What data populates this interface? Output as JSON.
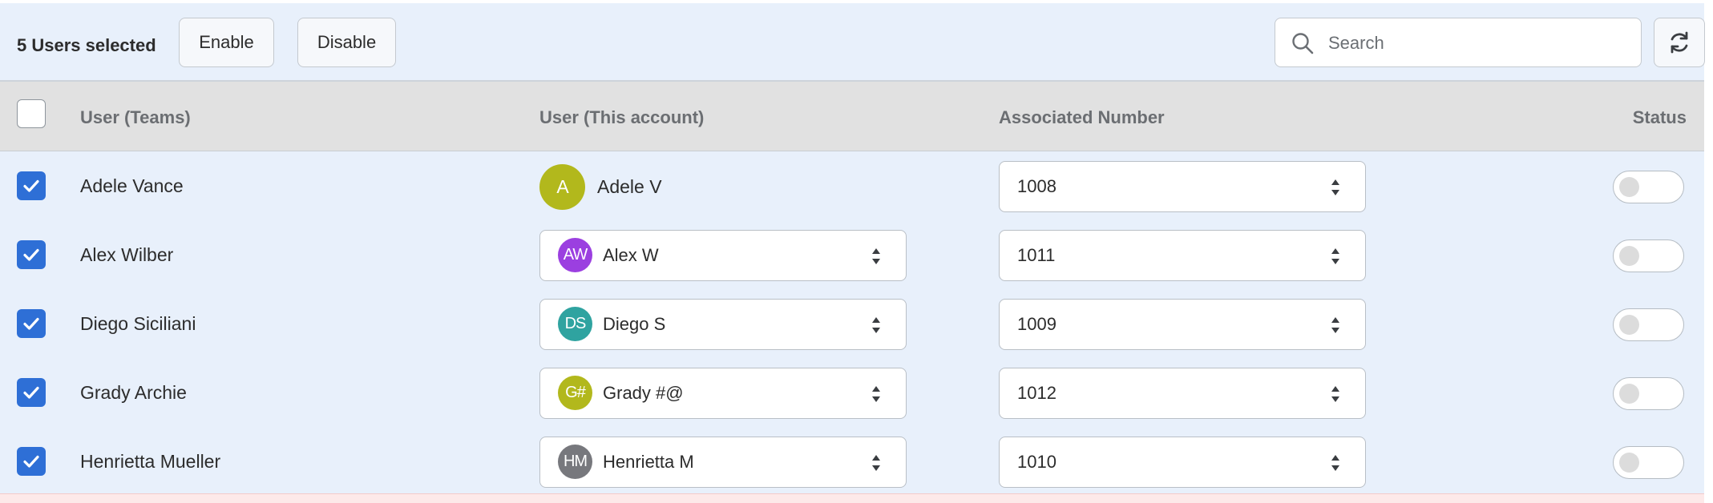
{
  "toolbar": {
    "selected_text": "5 Users selected",
    "enable_label": "Enable",
    "disable_label": "Disable",
    "search_placeholder": "Search",
    "search_value": ""
  },
  "columns": {
    "teams": "User (Teams)",
    "account": "User (This account)",
    "number": "Associated Number",
    "status": "Status"
  },
  "header_checkbox_checked": false,
  "rows": [
    {
      "teams_user": "Adele Vance",
      "account_user": "Adele V",
      "avatar_initials": "A",
      "avatar_color": "#b2b81c",
      "account_dropdown": false,
      "number": "1008",
      "checked": true,
      "status_enabled": false
    },
    {
      "teams_user": "Alex Wilber",
      "account_user": "Alex W",
      "avatar_initials": "AW",
      "avatar_color": "#9b3fe0",
      "account_dropdown": true,
      "number": "1011",
      "checked": true,
      "status_enabled": false
    },
    {
      "teams_user": "Diego Siciliani",
      "account_user": "Diego S",
      "avatar_initials": "DS",
      "avatar_color": "#2fa3a0",
      "account_dropdown": true,
      "number": "1009",
      "checked": true,
      "status_enabled": false
    },
    {
      "teams_user": "Grady Archie",
      "account_user": "Grady #@",
      "avatar_initials": "G#",
      "avatar_color": "#b2b81c",
      "account_dropdown": true,
      "number": "1012",
      "checked": true,
      "status_enabled": false
    },
    {
      "teams_user": "Henrietta Mueller",
      "account_user": "Henrietta M",
      "avatar_initials": "HM",
      "avatar_color": "#77787d",
      "account_dropdown": true,
      "number": "1010",
      "checked": true,
      "status_enabled": false
    }
  ],
  "colors": {
    "accent": "#2e6fd6",
    "toolbar_bg": "#e8f0fb",
    "header_bg": "#e1e1e1",
    "row_bg": "#e8f0fb",
    "error_strip": "#fde9e9"
  },
  "icons": {
    "search": "search-icon",
    "refresh": "refresh-icon",
    "checkmark": "checkmark-icon",
    "chevron": "chevron-up-down-icon"
  }
}
